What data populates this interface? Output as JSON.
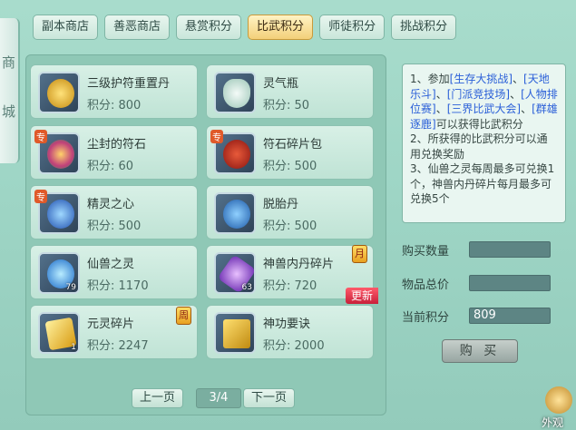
{
  "sidebar": {
    "chars": [
      "商",
      "城"
    ]
  },
  "tabs": [
    {
      "label": "副本商店",
      "active": false
    },
    {
      "label": "善恶商店",
      "active": false
    },
    {
      "label": "悬赏积分",
      "active": false
    },
    {
      "label": "比武积分",
      "active": true
    },
    {
      "label": "师徒积分",
      "active": false
    },
    {
      "label": "挑战积分",
      "active": false
    }
  ],
  "items": [
    {
      "name": "三级护符重置丹",
      "price": "积分: 800",
      "icon": "golden-talisman-icon",
      "color": "#e8b830"
    },
    {
      "name": "灵气瓶",
      "price": "积分: 50",
      "icon": "spirit-bottle-icon",
      "color": "#cfe7dd"
    },
    {
      "name": "尘封的符石",
      "price": "积分: 60",
      "icon": "rune-stone-icon",
      "color": "#c85aa0",
      "tag": "专"
    },
    {
      "name": "符石碎片包",
      "price": "积分: 500",
      "icon": "rune-fragment-bag-icon",
      "color": "#b8261c",
      "tag": "专"
    },
    {
      "name": "精灵之心",
      "price": "积分: 500",
      "icon": "spirit-heart-icon",
      "color": "#3f86e0",
      "tag": "专"
    },
    {
      "name": "脱胎丹",
      "price": "积分: 500",
      "icon": "rebirth-pill-icon",
      "color": "#3b82c9"
    },
    {
      "name": "仙兽之灵",
      "price": "积分: 1170",
      "icon": "beast-spirit-orb-icon",
      "color": "#3aa0e8",
      "count": "79"
    },
    {
      "name": "神兽内丹碎片",
      "price": "积分: 720",
      "icon": "beast-core-fragment-icon",
      "color": "#a05ad8",
      "count": "63",
      "badge": "月",
      "new": "更新"
    },
    {
      "name": "元灵碎片",
      "price": "积分: 2247",
      "icon": "yuanling-fragment-icon",
      "color": "#f0c030",
      "count": "1",
      "badge": "周"
    },
    {
      "name": "神功要诀",
      "price": "积分: 2000",
      "icon": "skill-book-icon",
      "color": "#e2b020"
    }
  ],
  "info": {
    "text1": "1、参加",
    "links": [
      "[生存大挑战]",
      "[天地乐斗]",
      "[门派竞技场]",
      "[人物排位赛]",
      "[三界比武大会]",
      "[群雄逐鹿]"
    ],
    "sep": "、",
    "text2": "可以获得比武积分",
    "line2": "2、所获得的比武积分可以通用兑换奖励",
    "line3": "3、仙兽之灵每周最多可兑换1个，神兽内丹碎片每月最多可兑换5个"
  },
  "form": {
    "qty_label": "购买数量",
    "qty_value": "",
    "total_label": "物品总价",
    "total_value": "",
    "current_label": "当前积分",
    "current_value": "809",
    "buy_label": "购 买"
  },
  "pager": {
    "prev": "上一页",
    "page": "3/4",
    "next": "下一页"
  },
  "corner": {
    "label": "外观"
  }
}
